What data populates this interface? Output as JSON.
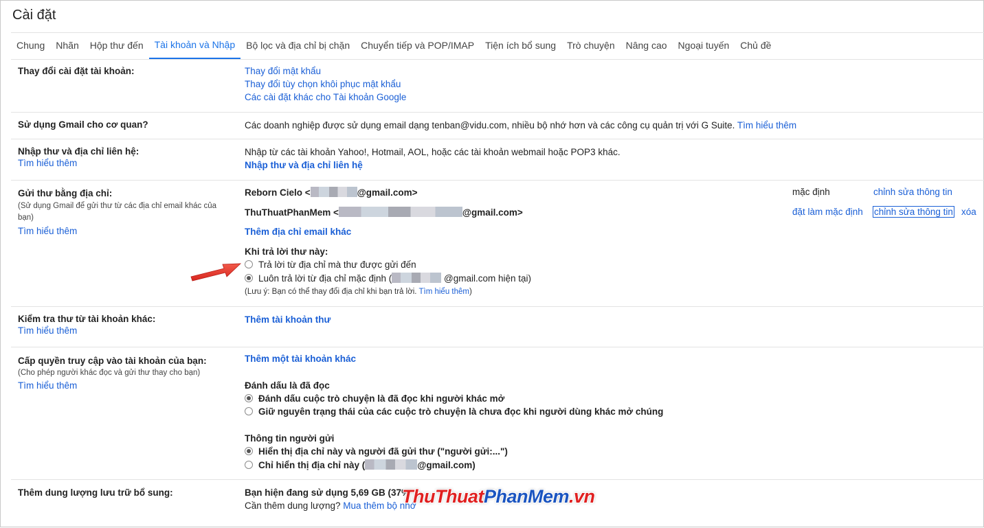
{
  "page": {
    "title": "Cài đặt"
  },
  "tabs": [
    "Chung",
    "Nhãn",
    "Hộp thư đến",
    "Tài khoản và Nhập",
    "Bộ lọc và địa chỉ bị chặn",
    "Chuyển tiếp và POP/IMAP",
    "Tiện ích bổ sung",
    "Trò chuyện",
    "Nâng cao",
    "Ngoại tuyến",
    "Chủ đề"
  ],
  "active_tab": "Tài khoản và Nhập",
  "account_settings": {
    "label": "Thay đổi cài đặt tài khoản:",
    "links": [
      "Thay đổi mật khẩu",
      "Thay đổi tùy chọn khôi phục mật khẩu",
      "Các cài đặt khác cho Tài khoản Google"
    ]
  },
  "gmail_work": {
    "label": "Sử dụng Gmail cho cơ quan?",
    "text": "Các doanh nghiệp được sử dụng email dạng tenban@vidu.com, nhiều bộ nhớ hơn và các công cụ quản trị với G Suite.",
    "link": "Tìm hiểu thêm"
  },
  "import": {
    "label": "Nhập thư và địa chỉ liên hệ:",
    "learn": "Tìm hiểu thêm",
    "text": "Nhập từ các tài khoản Yahoo!, Hotmail, AOL, hoặc các tài khoản webmail hoặc POP3 khác.",
    "action": "Nhập thư và địa chỉ liên hệ"
  },
  "send_as": {
    "label": "Gửi thư bằng địa chỉ:",
    "sub": "(Sử dụng Gmail để gửi thư từ các địa chỉ email khác của bạn)",
    "learn": "Tìm hiểu thêm",
    "accounts": [
      {
        "name_prefix": "Reborn Cielo <",
        "suffix": "@gmail.com>",
        "status": "mặc định",
        "edit": "chỉnh sửa thông tin"
      },
      {
        "name_prefix": "ThuThuatPhanMem <",
        "suffix": "@gmail.com>",
        "status": "đặt làm mặc định",
        "edit": "chỉnh sửa thông tin",
        "delete": "xóa"
      }
    ],
    "add": "Thêm địa chỉ email khác",
    "reply_heading": "Khi trả lời thư này:",
    "reply_opt1": "Trả lời từ địa chỉ mà thư được gửi đến",
    "reply_opt2_prefix": "Luôn trả lời từ địa chỉ mặc định (",
    "reply_opt2_suffix": "@gmail.com hiện tại)",
    "reply_selected": 2,
    "note_prefix": "(Lưu ý: Bạn có thể thay đổi địa chỉ khi bạn trả lời.",
    "note_link": "Tìm hiểu thêm",
    "note_suffix": ")"
  },
  "check_mail": {
    "label": "Kiểm tra thư từ tài khoản khác:",
    "learn": "Tìm hiểu thêm",
    "action": "Thêm tài khoản thư"
  },
  "grant": {
    "label": "Cấp quyền truy cập vào tài khoản của bạn:",
    "sub": "(Cho phép người khác đọc và gửi thư thay cho bạn)",
    "learn": "Tìm hiểu thêm",
    "action": "Thêm một tài khoản khác",
    "mark_heading": "Đánh dấu là đã đọc",
    "mark_opt1": "Đánh dấu cuộc trò chuyện là đã đọc khi người khác mở",
    "mark_opt2": "Giữ nguyên trạng thái của các cuộc trò chuyện là chưa đọc khi người dùng khác mở chúng",
    "mark_selected": 1,
    "sender_heading": "Thông tin người gửi",
    "sender_opt1": "Hiển thị địa chỉ này và người đã gửi thư (\"người gửi:...\")",
    "sender_opt2_prefix": "Chỉ hiển thị địa chỉ này (",
    "sender_opt2_suffix": "@gmail.com)",
    "sender_selected": 1
  },
  "storage": {
    "label": "Thêm dung lượng lưu trữ bổ sung:",
    "text": "Bạn hiện đang sử dụng 5,69 GB (37%",
    "need": "Cần thêm dung lượng?",
    "buy": "Mua thêm bộ nhớ"
  },
  "watermark": {
    "part1": "ThuThuat",
    "part2": "PhanMem",
    "part3": ".vn"
  },
  "colors": {
    "link": "#1a5fd6",
    "active_tab": "#1a73e8",
    "arrow": "#e8332e"
  }
}
